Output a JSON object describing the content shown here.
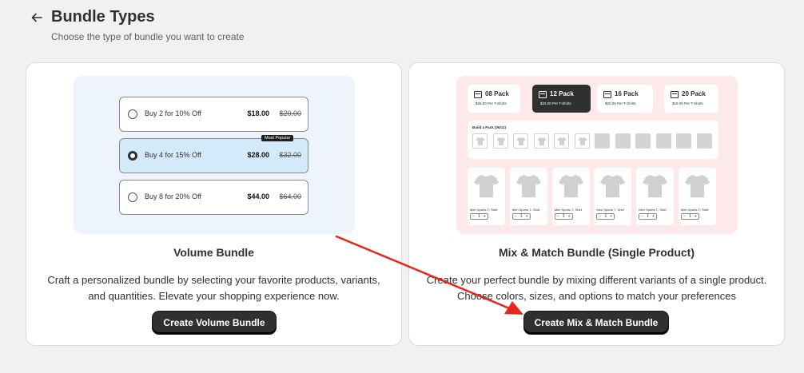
{
  "header": {
    "title": "Bundle Types",
    "subtitle": "Choose the type of bundle you want to create",
    "back_icon": "arrow-left-icon"
  },
  "volume_card": {
    "options": [
      {
        "label": "Buy 2 for 10% Off",
        "price": "$18.00",
        "was": "$20.00",
        "selected": false
      },
      {
        "label": "Buy 4 for 15% Off",
        "price": "$28.00",
        "was": "$32.00",
        "selected": true,
        "badge": "Most Popular"
      },
      {
        "label": "Buy 8 for 20% Off",
        "price": "$44.00",
        "was": "$64.00",
        "selected": false
      }
    ],
    "title": "Volume Bundle",
    "description": "Craft a personalized bundle by selecting your favorite products, variants, and quantities. Elevate your shopping experience now.",
    "cta": "Create Volume Bundle"
  },
  "mix_card": {
    "packs": [
      {
        "name": "08 Pack",
        "sub": "$26.00 Per T-Shirts",
        "active": false
      },
      {
        "name": "12 Pack",
        "sub": "$22.00 Per T-Shirts",
        "active": true
      },
      {
        "name": "16 Pack",
        "sub": "$20.00 Per T-Shirts",
        "active": false
      },
      {
        "name": "20 Pack",
        "sub": "$18.00 Per T-Shirts",
        "active": false
      }
    ],
    "build_label": "Build a Pack (06/11)",
    "slots_filled": 6,
    "slots_total": 12,
    "product_name": "Men Sports T- Shirt",
    "stepper": {
      "minus": "−",
      "qty": "1",
      "plus": "+"
    },
    "title": "Mix & Match Bundle (Single Product)",
    "description": "Create your perfect bundle by mixing different variants of a single product. Choose colors, sizes, and options to match your preferences",
    "cta": "Create Mix & Match Bundle"
  },
  "colors": {
    "cta_bg": "#303030",
    "annotation_arrow": "#e8251f",
    "volume_preview_bg": "#eef4fb",
    "mix_preview_bg": "#fde8ea"
  }
}
